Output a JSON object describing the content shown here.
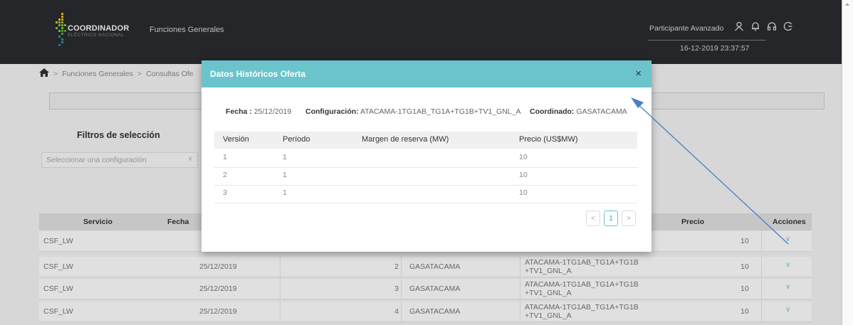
{
  "header": {
    "brand_name": "COORDINADOR",
    "brand_sub": "ELÉCTRICO NACIONAL",
    "app_title": "Funciones Generales",
    "user_role": "Participante Avanzado",
    "datetime": "16-12-2019 23:37:57",
    "icons": [
      "user-icon",
      "bell-icon",
      "headset-icon",
      "logout-icon"
    ]
  },
  "breadcrumb": {
    "items": [
      "Funciones Generales",
      "Consultas Ofe"
    ]
  },
  "filters": {
    "title": "Filtros de selección",
    "config_placeholder": "Seleccionar una configuración"
  },
  "main_table": {
    "headers": [
      "Servicio",
      "Fecha",
      "Precio",
      "Acciones"
    ],
    "rows": [
      {
        "servicio": "CSF_LW",
        "fecha": "",
        "version": "",
        "coordinado": "",
        "configuracion": "",
        "precio": "10"
      },
      {
        "servicio": "CSF_LW",
        "fecha": "25/12/2019",
        "version": "2",
        "coordinado": "GASATACAMA",
        "configuracion": "ATACAMA-1TG1AB_TG1A+TG1B +TV1_GNL_A",
        "precio": "10"
      },
      {
        "servicio": "CSF_LW",
        "fecha": "25/12/2019",
        "version": "3",
        "coordinado": "GASATACAMA",
        "configuracion": "ATACAMA-1TG1AB_TG1A+TG1B +TV1_GNL_A",
        "precio": "10"
      },
      {
        "servicio": "CSF_LW",
        "fecha": "25/12/2019",
        "version": "4",
        "coordinado": "GASATACAMA",
        "configuracion": "ATACAMA-1TG1AB_TG1A+TG1B +TV1_GNL_A",
        "precio": "10"
      }
    ]
  },
  "modal": {
    "title": "Datos Históricos Oferta",
    "close": "×",
    "fecha_label": "Fecha :",
    "fecha_value": "25/12/2019",
    "config_label": "Configuración:",
    "config_value": "ATACAMA-1TG1AB_TG1A+TG1B+TV1_GNL_A",
    "coord_label": "Coordinado:",
    "coord_value": "GASATACAMA",
    "table_headers": [
      "Versión",
      "Período",
      "Margen de reserva (MW)",
      "Precio (US$MW)"
    ],
    "rows": [
      {
        "version": "1",
        "periodo": "1",
        "margen": "",
        "precio": "10"
      },
      {
        "version": "2",
        "periodo": "1",
        "margen": "",
        "precio": "10"
      },
      {
        "version": "3",
        "periodo": "1",
        "margen": "",
        "precio": "10"
      }
    ],
    "pager": {
      "prev": "<",
      "current": "1",
      "next": ">"
    }
  },
  "colors": {
    "header_bg": "#2a2c30",
    "modal_accent": "#6bc4cc",
    "arrow": "#4a7cc9",
    "logo_green": "#8cc63f",
    "logo_yellow": "#f2c200"
  }
}
